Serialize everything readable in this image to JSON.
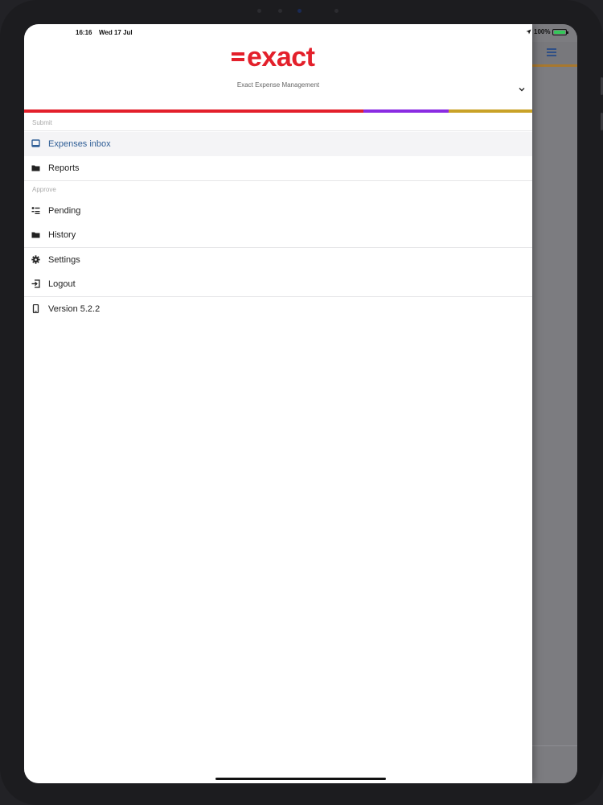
{
  "status_bar": {
    "time": "16:16",
    "date": "Wed 17 Jul",
    "battery": "100%"
  },
  "header": {
    "logo_text": "exact",
    "subtitle": "Exact Expense Management",
    "brand_color": "#e3202b",
    "stripe_colors": [
      "#e3202b",
      "#8a2be2",
      "#c9a227"
    ]
  },
  "menu": {
    "submit_label": "Submit",
    "approve_label": "Approve",
    "items": [
      {
        "label": "Expenses inbox",
        "icon": "inbox-icon",
        "active": true
      },
      {
        "label": "Reports",
        "icon": "folder-icon",
        "active": false
      },
      {
        "label": "Pending",
        "icon": "checklist-icon",
        "active": false
      },
      {
        "label": "History",
        "icon": "folder-icon",
        "active": false
      },
      {
        "label": "Settings",
        "icon": "gear-icon",
        "active": false
      },
      {
        "label": "Logout",
        "icon": "logout-icon",
        "active": false
      },
      {
        "label": "Version 5.2.2",
        "icon": "phone-icon",
        "active": false
      }
    ]
  },
  "accent_color": "#2f5e96"
}
